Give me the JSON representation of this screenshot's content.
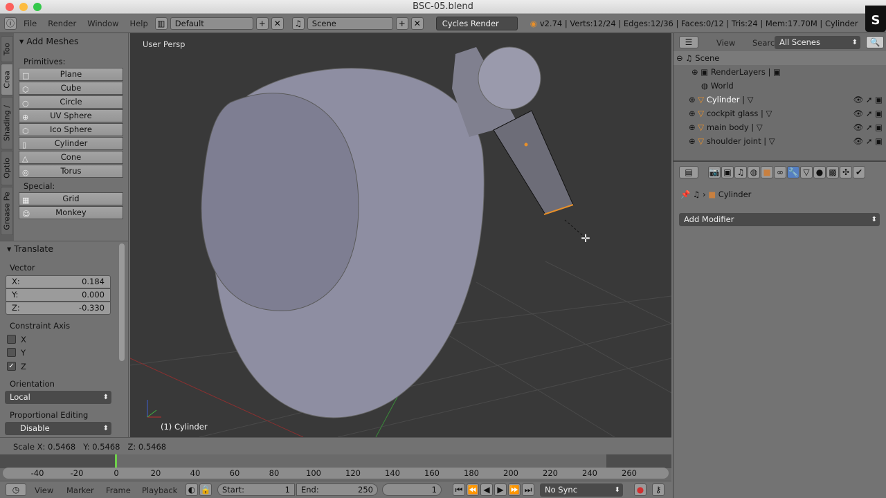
{
  "window": {
    "title": "BSC-05.blend"
  },
  "topbar": {
    "menus": [
      "File",
      "Render",
      "Window",
      "Help"
    ],
    "layout": "Default",
    "scene": "Scene",
    "engine": "Cycles Render",
    "stats": "v2.74 | Verts:12/24 | Edges:12/36 | Faces:0/12 | Tris:24 | Mem:17.70M | Cylinder",
    "badge": "S"
  },
  "tool_tabs": [
    "Too",
    "Crea",
    "Shading /",
    "Optio",
    "Grease Pe"
  ],
  "add_meshes": {
    "title": "Add Meshes",
    "primitives_label": "Primitives:",
    "primitives": [
      "Plane",
      "Cube",
      "Circle",
      "UV Sphere",
      "Ico Sphere",
      "Cylinder",
      "Cone",
      "Torus"
    ],
    "special_label": "Special:",
    "special": [
      "Grid",
      "Monkey"
    ]
  },
  "translate": {
    "title": "Translate",
    "vector_label": "Vector",
    "x_label": "X:",
    "x": "0.184",
    "y_label": "Y:",
    "y": "0.000",
    "z_label": "Z:",
    "z": "-0.330",
    "constraint_label": "Constraint Axis",
    "axes": [
      {
        "label": "X",
        "checked": false
      },
      {
        "label": "Y",
        "checked": false
      },
      {
        "label": "Z",
        "checked": true
      }
    ],
    "orientation_label": "Orientation",
    "orientation": "Local",
    "prop_label": "Proportional Editing",
    "prop": "Disable"
  },
  "viewport": {
    "view_name": "User Persp",
    "object_label": "(1) Cylinder"
  },
  "status": "Scale X: 0.5468   Y: 0.5468   Z: 0.5468",
  "timeline": {
    "ticks": [
      "-40",
      "-20",
      "0",
      "20",
      "40",
      "60",
      "80",
      "100",
      "120",
      "140",
      "160",
      "180",
      "200",
      "220",
      "240",
      "260"
    ],
    "current_frame": 0,
    "menus": [
      "View",
      "Marker",
      "Frame",
      "Playback"
    ],
    "start_label": "Start:",
    "start": "1",
    "end_label": "End:",
    "end": "250",
    "frame": "1",
    "sync": "No Sync"
  },
  "outliner": {
    "menus": [
      "View",
      "Search"
    ],
    "filter": "All Scenes",
    "items": [
      {
        "label": "Scene",
        "icon": "scene-icon"
      },
      {
        "label": "RenderLayers",
        "icon": "renderlayers-icon"
      },
      {
        "label": "World",
        "icon": "world-icon"
      },
      {
        "label": "Cylinder",
        "icon": "mesh-icon"
      },
      {
        "label": "cockpit glass",
        "icon": "mesh-icon"
      },
      {
        "label": "main body",
        "icon": "mesh-icon"
      },
      {
        "label": "shoulder joint",
        "icon": "mesh-icon"
      }
    ]
  },
  "properties": {
    "breadcrumb_object": "Cylinder",
    "add_modifier": "Add Modifier",
    "active_tab": "modifiers"
  },
  "colors": {
    "accent": "#5680c2",
    "mesh_orange": "#e8902a",
    "playhead": "#6fd04a"
  }
}
